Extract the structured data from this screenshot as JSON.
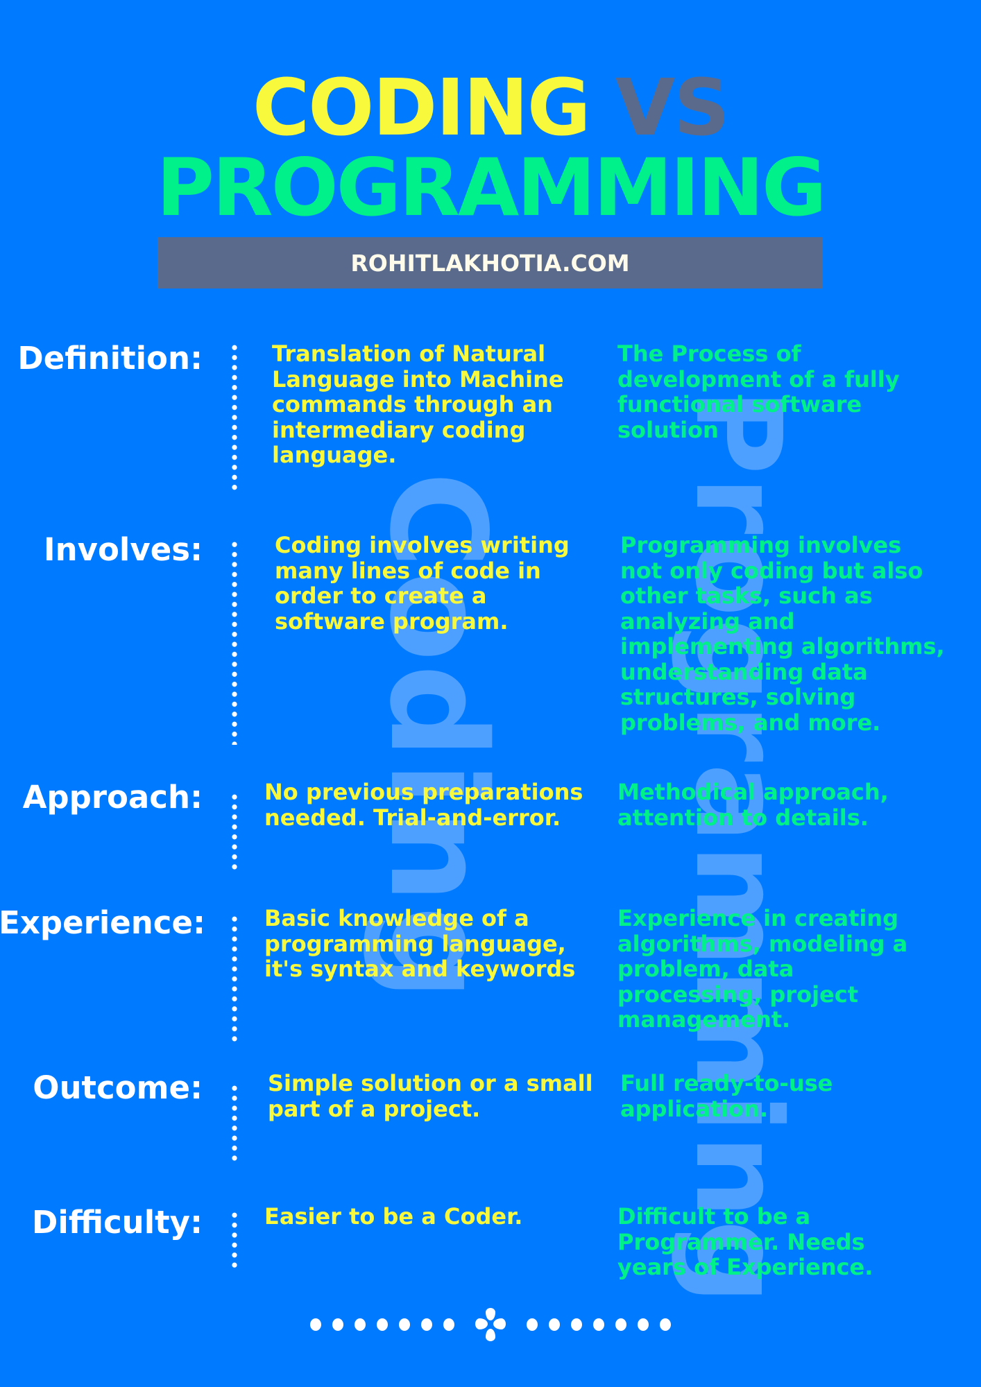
{
  "colors": {
    "background": "#007BFF",
    "coding_accent": "#F8F83C",
    "programming_accent": "#00F08A",
    "vs_and_banner": "#5A6A8C",
    "watermark": "#4DA0FF",
    "label": "#FFFFFF"
  },
  "title": {
    "coding": "CODING",
    "vs": "VS",
    "programming": "PROGRAMMING"
  },
  "banner": {
    "text": "ROHITLAKHOTIA.COM"
  },
  "watermarks": {
    "left": "Coding",
    "right": "Programming"
  },
  "rows": [
    {
      "label": "Definition:",
      "coding": "Translation of Natural\nLanguage into Machine\ncommands through an\nintermediary coding\nlanguage.",
      "programming": "The Process of\ndevelopment of a fully\nfunctional software\nsolution"
    },
    {
      "label": "Involves:",
      "coding": "Coding involves writing\nmany lines of code in\norder to create a\nsoftware program.",
      "programming": "Programming involves\nnot only coding but also\nother tasks, such as\nanalyzing and\nimplementing algorithms,\nunderstanding data\nstructures, solving\nproblems, and more."
    },
    {
      "label": "Approach:",
      "coding": "No previous preparations\nneeded. Trial-and-error.",
      "programming": "Methodical approach,\nattention to details."
    },
    {
      "label": "Experience:",
      "coding": "Basic knowledge of a\nprogramming language,\nit's syntax and keywords",
      "programming": "Experience in creating\nalgorithms, modeling a\nproblem, data\nprocessing, project\nmanagement."
    },
    {
      "label": "Outcome:",
      "coding": "Simple solution or a small\npart of a project.",
      "programming": "Full ready-to-use\napplication."
    },
    {
      "label": "Difficulty:",
      "coding": "Easier to be a Coder.",
      "programming": "Difficult to be a\nProgrammer. Needs\nyears of Experience."
    }
  ],
  "footer": {
    "ornament_icon": "flower-divider-icon",
    "dots_each_side": 7
  }
}
